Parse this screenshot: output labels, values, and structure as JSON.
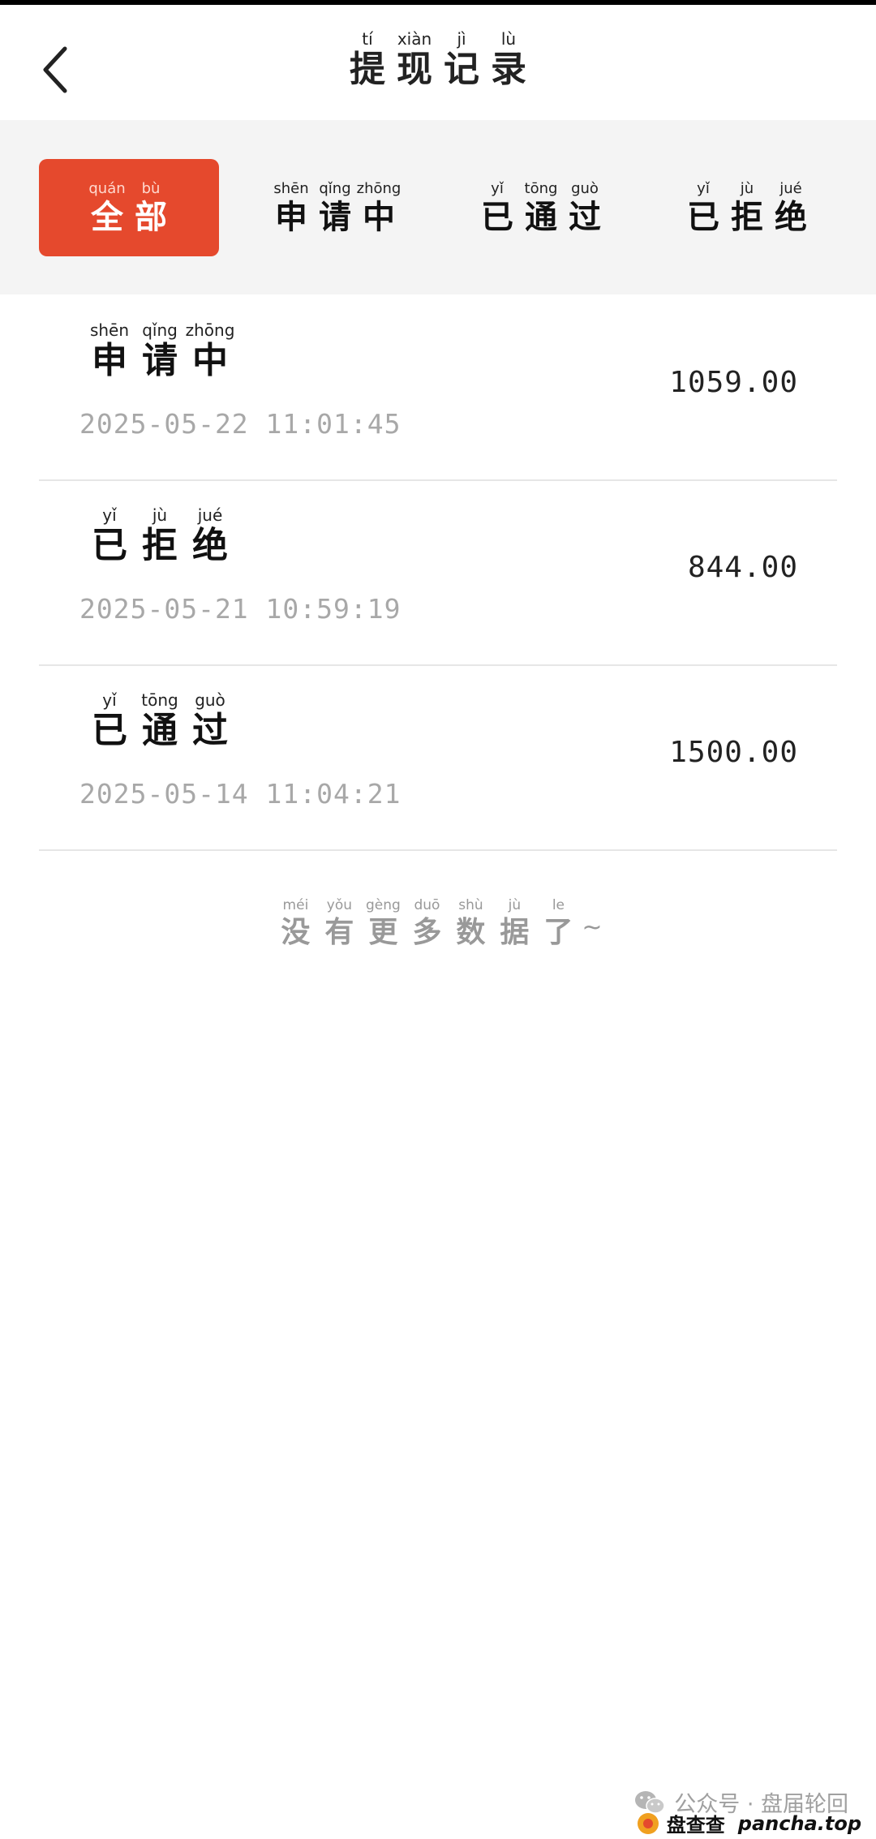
{
  "header": {
    "title": [
      {
        "py": "tí",
        "hz": "提"
      },
      {
        "py": "xiàn",
        "hz": "现"
      },
      {
        "py": "jì",
        "hz": "记"
      },
      {
        "py": "lù",
        "hz": "录"
      }
    ]
  },
  "tabs": [
    {
      "active": true,
      "syllables": [
        {
          "py": "quán",
          "hz": "全"
        },
        {
          "py": "bù",
          "hz": "部"
        }
      ]
    },
    {
      "active": false,
      "syllables": [
        {
          "py": "shēn",
          "hz": "申"
        },
        {
          "py": "qǐng",
          "hz": "请"
        },
        {
          "py": "zhōng",
          "hz": "中"
        }
      ]
    },
    {
      "active": false,
      "syllables": [
        {
          "py": "yǐ",
          "hz": "已"
        },
        {
          "py": "tōng",
          "hz": "通"
        },
        {
          "py": "guò",
          "hz": "过"
        }
      ]
    },
    {
      "active": false,
      "syllables": [
        {
          "py": "yǐ",
          "hz": "已"
        },
        {
          "py": "jù",
          "hz": "拒"
        },
        {
          "py": "jué",
          "hz": "绝"
        }
      ]
    }
  ],
  "records": [
    {
      "status": [
        {
          "py": "shēn",
          "hz": "申"
        },
        {
          "py": "qǐng",
          "hz": "请"
        },
        {
          "py": "zhōng",
          "hz": "中"
        }
      ],
      "time": "2025-05-22 11:01:45",
      "amount": "1059.00"
    },
    {
      "status": [
        {
          "py": "yǐ",
          "hz": "已"
        },
        {
          "py": "jù",
          "hz": "拒"
        },
        {
          "py": "jué",
          "hz": "绝"
        }
      ],
      "time": "2025-05-21 10:59:19",
      "amount": "844.00"
    },
    {
      "status": [
        {
          "py": "yǐ",
          "hz": "已"
        },
        {
          "py": "tōng",
          "hz": "通"
        },
        {
          "py": "guò",
          "hz": "过"
        }
      ],
      "time": "2025-05-14 11:04:21",
      "amount": "1500.00"
    }
  ],
  "no_more": {
    "syllables": [
      {
        "py": "méi",
        "hz": "没"
      },
      {
        "py": "yǒu",
        "hz": "有"
      },
      {
        "py": "gèng",
        "hz": "更"
      },
      {
        "py": "duō",
        "hz": "多"
      },
      {
        "py": "shù",
        "hz": "数"
      },
      {
        "py": "jù",
        "hz": "据"
      },
      {
        "py": "le",
        "hz": "了"
      }
    ],
    "suffix": "~"
  },
  "watermark": {
    "line1": "公众号 · 盘届轮回",
    "brand_cn": "盘查查",
    "brand_url": "pancha.top"
  },
  "colors": {
    "accent": "#e5492d",
    "time_text": "#a8a8a8"
  }
}
